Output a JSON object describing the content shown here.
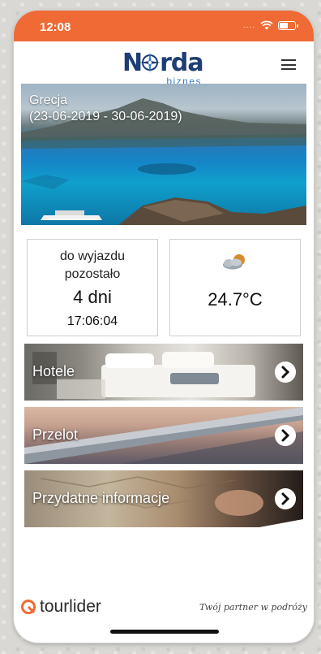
{
  "status_bar": {
    "time": "12:08",
    "signal_dots": "....",
    "wifi_icon": "wifi-icon",
    "battery_icon": "battery-charging-icon"
  },
  "header": {
    "logo_text_left": "N",
    "logo_text_right": "rda",
    "logo_sub": "biznes",
    "menu_icon": "hamburger-menu-icon"
  },
  "hero": {
    "country": "Grecja",
    "dates": "(23-06-2019 - 30-06-2019)"
  },
  "countdown": {
    "label_line1": "do wyjazdu",
    "label_line2": "pozostało",
    "days": "4 dni",
    "clock": "17:06:04"
  },
  "weather": {
    "icon": "partly-cloudy-icon",
    "temperature": "24.7°C"
  },
  "tiles": [
    {
      "label": "Hotele"
    },
    {
      "label": "Przelot"
    },
    {
      "label": "Przydatne informacje"
    }
  ],
  "footer": {
    "brand": "tourlider",
    "tagline": "Twój partner w podróży"
  },
  "colors": {
    "accent": "#ef6a34",
    "logo_navy": "#1d3e74",
    "logo_blue": "#3d7dc6"
  }
}
